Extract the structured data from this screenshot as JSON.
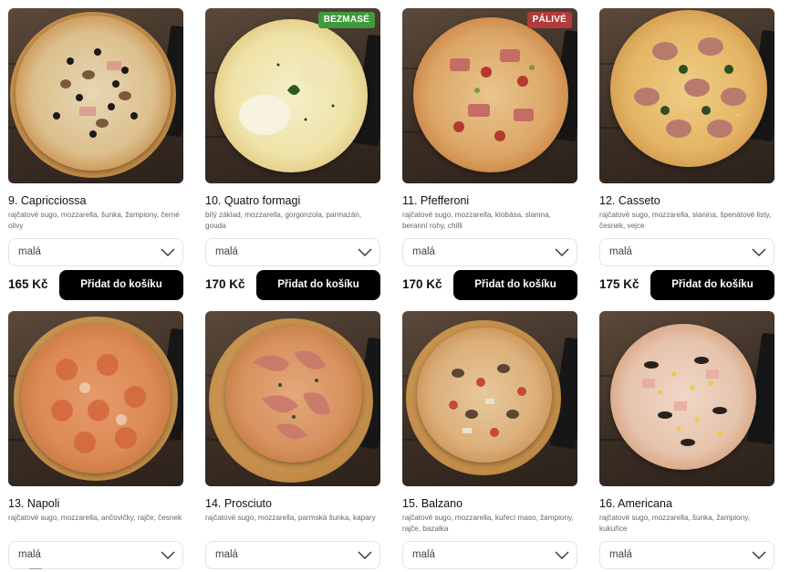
{
  "colors": {
    "bezmase_badge": "#3f9a3c",
    "palive_badge": "#b23b3b",
    "button_bg": "#000000"
  },
  "products": [
    {
      "name": "9. Capricciossa",
      "ingredients": "rajčatové sugo, mozzarella, šunka, žampiony, černé olivy",
      "size": "malá",
      "price": "165 Kč",
      "button": "Přidat do košíku",
      "badge": ""
    },
    {
      "name": "10. Quatro formagi",
      "ingredients": "bílý základ, mozzarella, gorgonzola, parmazán, gouda",
      "size": "malá",
      "price": "170 Kč",
      "button": "Přidat do košíku",
      "badge": "BEZMASÉ"
    },
    {
      "name": "11. Pfefferoni",
      "ingredients": "rajčatové sugo, mozzarella, klobása, slanina, beranní rohy, chilli",
      "size": "malá",
      "price": "170 Kč",
      "button": "Přidat do košíku",
      "badge": "PÁLIVÉ"
    },
    {
      "name": "12. Casseto",
      "ingredients": "rajčatové sugo, mozzarella, slanina, špenátové listy, česnek, vejce",
      "size": "malá",
      "price": "175 Kč",
      "button": "Přidat do košíku",
      "badge": ""
    },
    {
      "name": "13. Napoli",
      "ingredients": "rajčatové sugo, mozzarella, ančovičky, rajče, česnek",
      "size": "malá"
    },
    {
      "name": "14. Prosciuto",
      "ingredients": "rajčatové sugo, mozzarella, parmská šunka, kapary",
      "size": "malá"
    },
    {
      "name": "15. Balzano",
      "ingredients": "rajčatové sugo, mozzarella, kuřecí maso, žampiony, rajče, bazalka",
      "size": "malá"
    },
    {
      "name": "16. Americana",
      "ingredients": "rajčatové sugo, mozzarella, šunka, žampiony, kukuřice",
      "size": "malá"
    }
  ]
}
